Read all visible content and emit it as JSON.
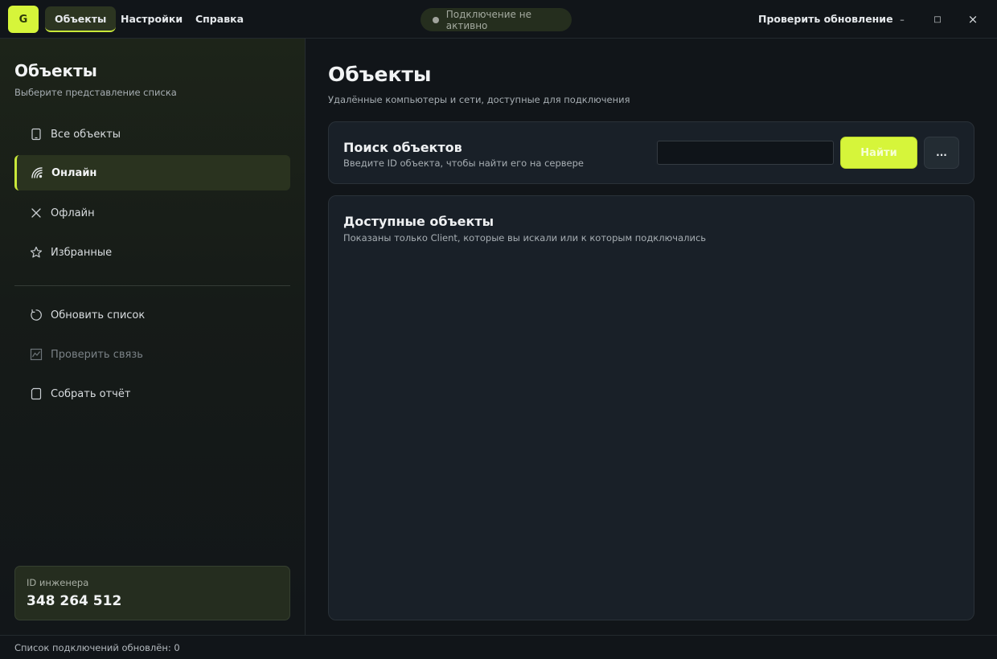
{
  "titlebar": {
    "logo_letter": "G",
    "tabs": [
      {
        "label": "Объекты",
        "active": true
      },
      {
        "label": "Настройки",
        "active": false
      },
      {
        "label": "Справка",
        "active": false
      }
    ],
    "connection_status": "Подключение не активно",
    "check_update_label": "Проверить обновление",
    "minimize_glyph": "–",
    "maximize_glyph": "□",
    "close_glyph": "×"
  },
  "sidebar": {
    "title": "Объекты",
    "subtitle": "Выберите представление списка",
    "nav": [
      {
        "label": "Все объекты",
        "icon": "tablet-icon",
        "active": false,
        "disabled": false
      },
      {
        "label": "Онлайн",
        "icon": "signal-icon",
        "active": true,
        "disabled": false
      },
      {
        "label": "Офлайн",
        "icon": "close-icon",
        "active": false,
        "disabled": false
      },
      {
        "label": "Избранные",
        "icon": "star-icon",
        "active": false,
        "disabled": false
      }
    ],
    "actions": [
      {
        "label": "Обновить список",
        "icon": "refresh-icon",
        "disabled": false
      },
      {
        "label": "Проверить связь",
        "icon": "chart-icon",
        "disabled": true
      },
      {
        "label": "Собрать отчёт",
        "icon": "document-icon",
        "disabled": false
      }
    ],
    "engineer": {
      "label": "ID инженера",
      "value": "348 264 512"
    }
  },
  "main": {
    "title": "Объекты",
    "subtitle": "Удалённые компьютеры и сети, доступные для подключения",
    "search_card": {
      "title": "Поиск объектов",
      "subtitle": "Введите ID объекта, чтобы найти его на сервере",
      "input_value": "",
      "input_placeholder": "",
      "find_label": "Найти",
      "more_label": "..."
    },
    "available_card": {
      "title": "Доступные объекты",
      "subtitle": "Показаны только Client, которые вы искали или к которым подключались"
    }
  },
  "statusbar": {
    "text": "Список подключений обновлён: 0"
  },
  "colors": {
    "accent": "#d6f53a",
    "background": "#111519",
    "card": "#192028"
  }
}
